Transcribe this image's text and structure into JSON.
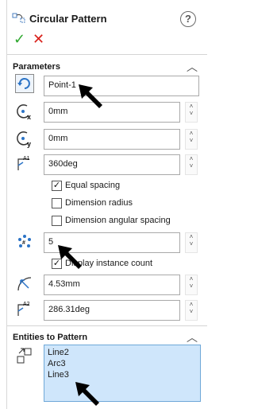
{
  "header": {
    "title": "Circular Pattern",
    "help": "?"
  },
  "actions": {
    "ok": "✓",
    "cancel": "✕"
  },
  "parameters": {
    "title": "Parameters",
    "axis_value": "Point-1",
    "x_value": "0mm",
    "y_value": "0mm",
    "angle_value": "360deg",
    "equal_spacing": {
      "label": "Equal spacing",
      "checked": "✓"
    },
    "dimension_radius": {
      "label": "Dimension radius"
    },
    "dimension_angular_spacing": {
      "label": "Dimension angular spacing"
    },
    "instance_count": "5",
    "display_instance_count": {
      "label": "Display instance count",
      "checked": "✓"
    },
    "radius_value": "4.53mm",
    "angle2_value": "286.31deg"
  },
  "entities": {
    "title": "Entities to Pattern",
    "items": [
      "Line2",
      "Arc3",
      "Line3"
    ]
  },
  "colors": {
    "ok": "#2fa82f",
    "cancel": "#d9221c",
    "list_bg": "#cfe6fb",
    "list_border": "#6fa8d8"
  }
}
